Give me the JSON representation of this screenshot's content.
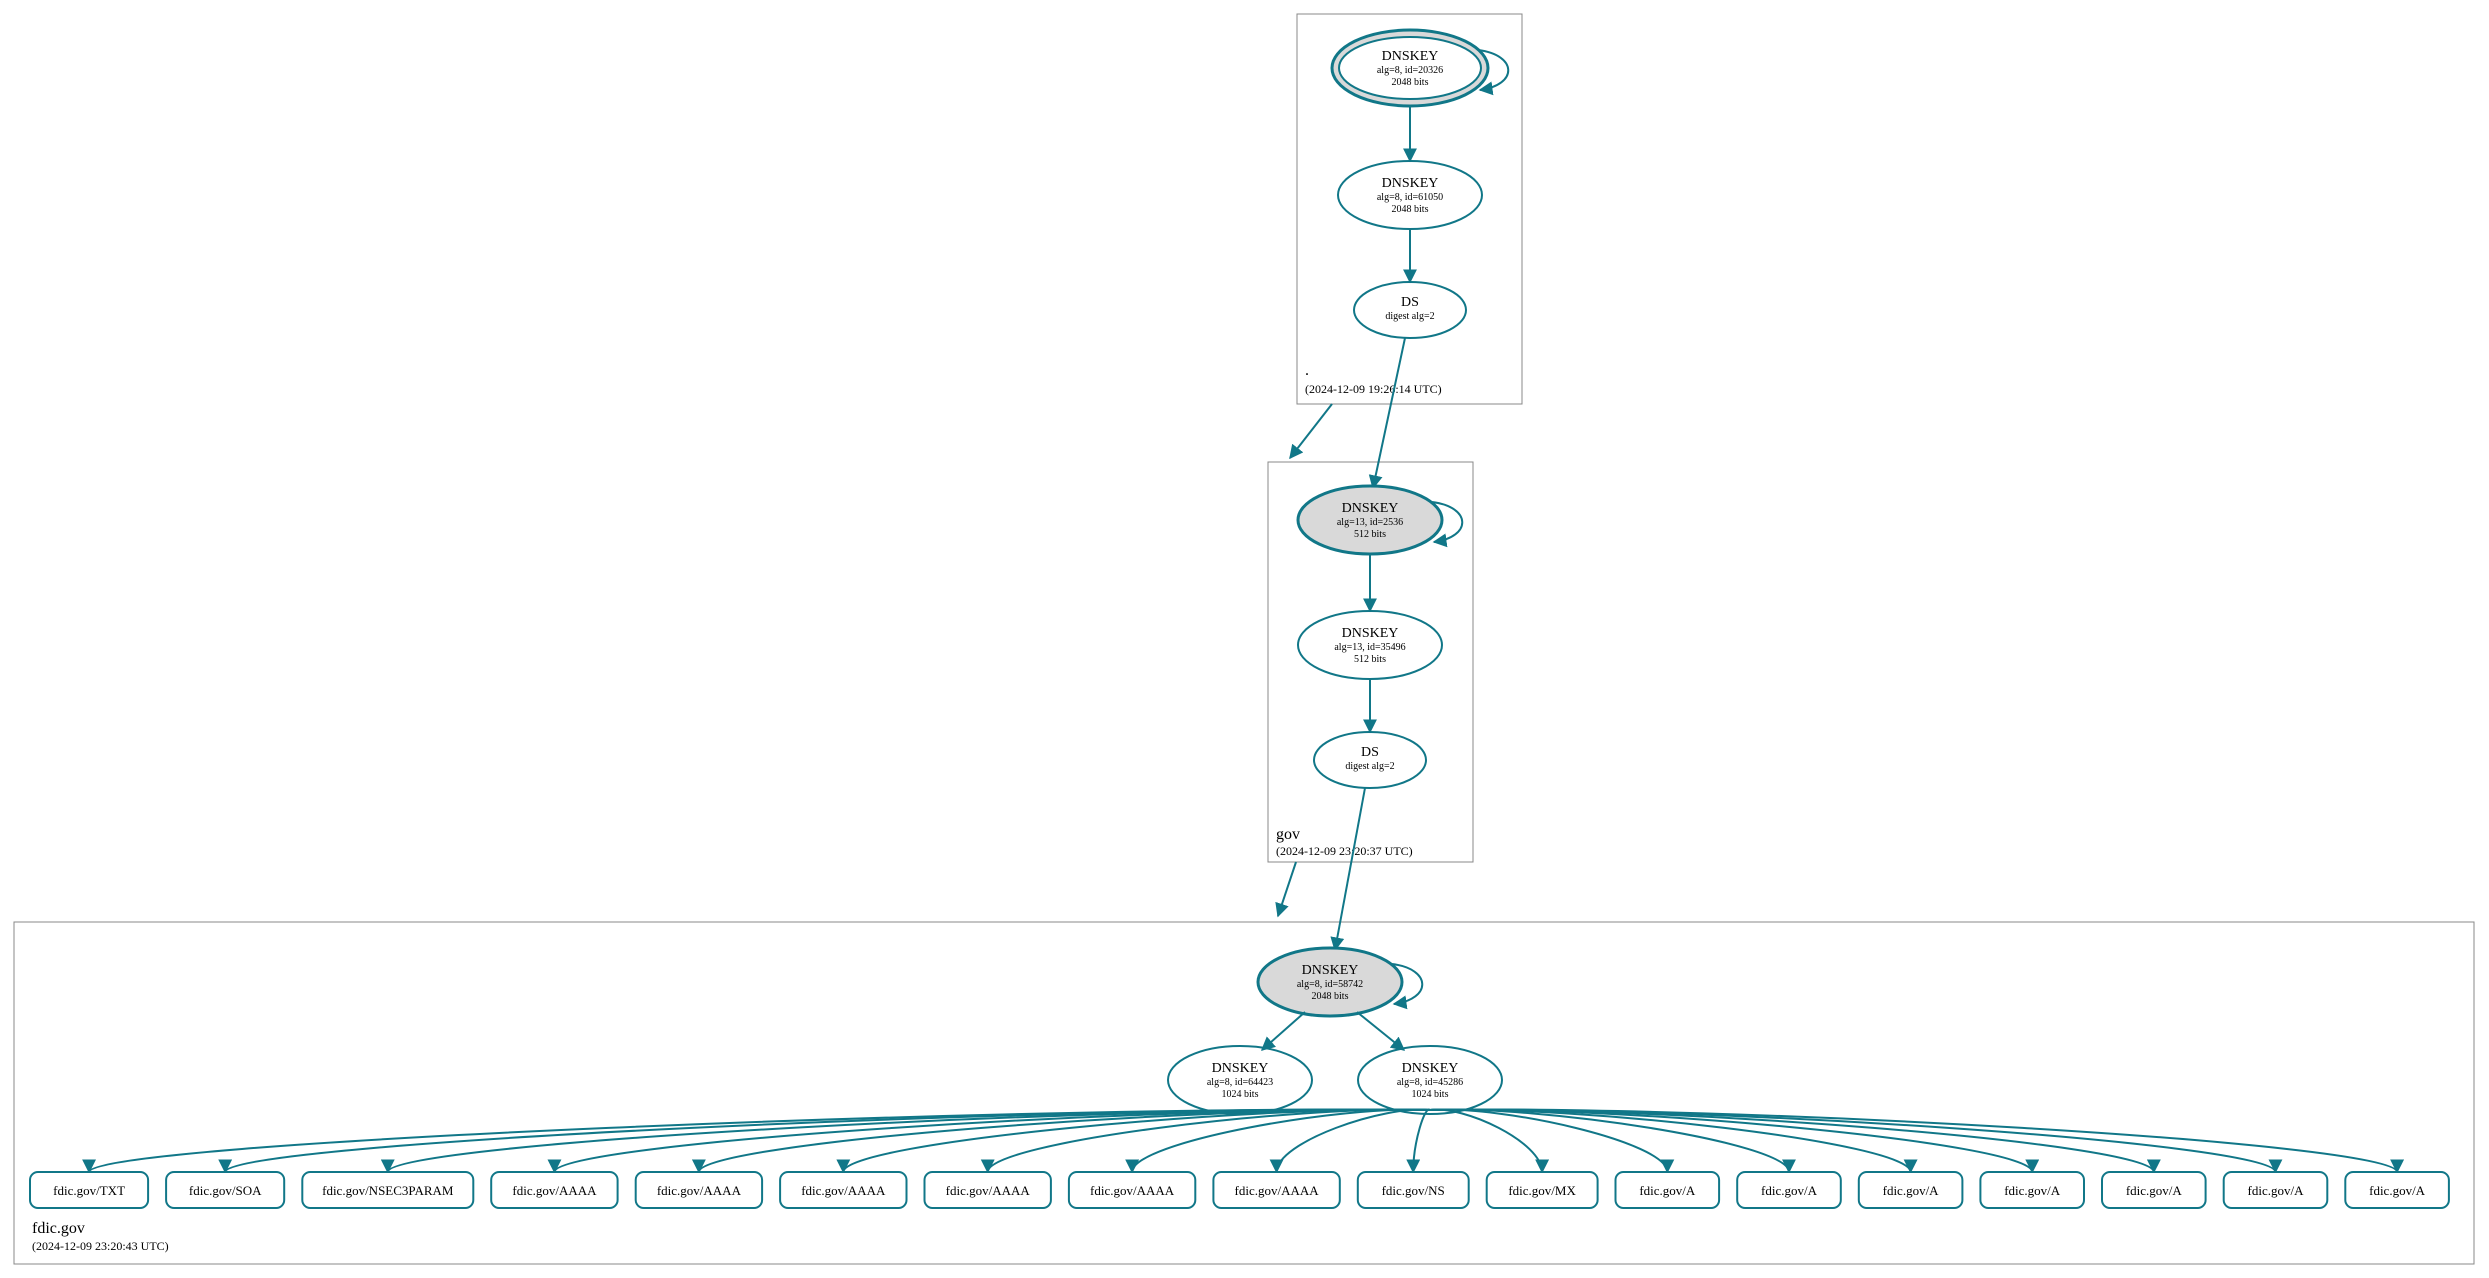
{
  "zones": {
    "root": {
      "label": ".",
      "timestamp": "(2024-12-09 19:26:14 UTC)",
      "nodes": {
        "ksk": {
          "title": "DNSKEY",
          "sub1": "alg=8, id=20326",
          "sub2": "2048 bits"
        },
        "zsk": {
          "title": "DNSKEY",
          "sub1": "alg=8, id=61050",
          "sub2": "2048 bits"
        },
        "ds": {
          "title": "DS",
          "sub1": "digest alg=2"
        }
      }
    },
    "gov": {
      "label": "gov",
      "timestamp": "(2024-12-09 23:20:37 UTC)",
      "nodes": {
        "ksk": {
          "title": "DNSKEY",
          "sub1": "alg=13, id=2536",
          "sub2": "512 bits"
        },
        "zsk": {
          "title": "DNSKEY",
          "sub1": "alg=13, id=35496",
          "sub2": "512 bits"
        },
        "ds": {
          "title": "DS",
          "sub1": "digest alg=2"
        }
      }
    },
    "fdic": {
      "label": "fdic.gov",
      "timestamp": "(2024-12-09 23:20:43 UTC)",
      "nodes": {
        "ksk": {
          "title": "DNSKEY",
          "sub1": "alg=8, id=58742",
          "sub2": "2048 bits"
        },
        "zskA": {
          "title": "DNSKEY",
          "sub1": "alg=8, id=64423",
          "sub2": "1024 bits"
        },
        "zskB": {
          "title": "DNSKEY",
          "sub1": "alg=8, id=45286",
          "sub2": "1024 bits"
        }
      }
    }
  },
  "leaves": [
    {
      "label": "fdic.gov/TXT"
    },
    {
      "label": "fdic.gov/SOA"
    },
    {
      "label": "fdic.gov/NSEC3PARAM"
    },
    {
      "label": "fdic.gov/AAAA"
    },
    {
      "label": "fdic.gov/AAAA"
    },
    {
      "label": "fdic.gov/AAAA"
    },
    {
      "label": "fdic.gov/AAAA"
    },
    {
      "label": "fdic.gov/AAAA"
    },
    {
      "label": "fdic.gov/AAAA"
    },
    {
      "label": "fdic.gov/NS"
    },
    {
      "label": "fdic.gov/MX"
    },
    {
      "label": "fdic.gov/A"
    },
    {
      "label": "fdic.gov/A"
    },
    {
      "label": "fdic.gov/A"
    },
    {
      "label": "fdic.gov/A"
    },
    {
      "label": "fdic.gov/A"
    },
    {
      "label": "fdic.gov/A"
    },
    {
      "label": "fdic.gov/A"
    }
  ]
}
